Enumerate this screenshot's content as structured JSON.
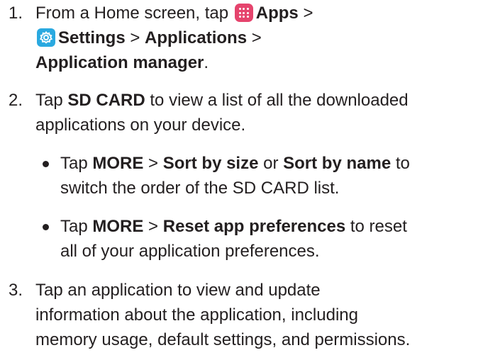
{
  "steps": [
    {
      "number": "1.",
      "line1_pre": "From a Home screen, tap",
      "apps_label": "Apps",
      "sep1": ">",
      "settings_label": "Settings",
      "sep2": ">",
      "applications_label": "Applications",
      "sep3": ">",
      "app_manager_label": "Application manager",
      "end": "."
    },
    {
      "number": "2.",
      "pre": "Tap",
      "sd_card": "SD CARD",
      "post_line1": "to view a list of all the downloaded",
      "line2": "applications on your device.",
      "bullets": [
        {
          "pre": "Tap",
          "more": "MORE",
          "sep": ">",
          "opt1": "Sort by size",
          "or": "or",
          "opt2": "Sort by name",
          "to": "to",
          "line2": "switch the order of the SD CARD list."
        },
        {
          "pre": "Tap",
          "more": "MORE",
          "sep": ">",
          "opt": "Reset app preferences",
          "to": "to reset",
          "line2": "all of your application preferences."
        }
      ]
    },
    {
      "number": "3.",
      "line1": "Tap an application to view and update",
      "line2": "information about the application, including",
      "line3": "memory usage, default settings, and permissions."
    }
  ],
  "icons": {
    "apps": "apps-grid-icon",
    "settings": "settings-gear-icon",
    "apps_color": "#e5446d",
    "settings_color": "#2aa9e0"
  }
}
